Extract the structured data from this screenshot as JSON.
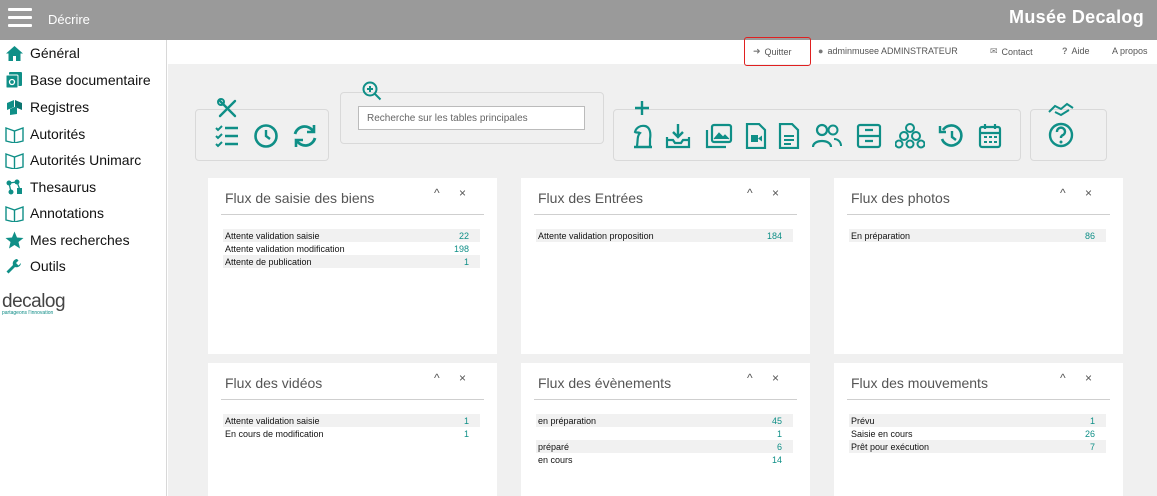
{
  "header": {
    "menu_label": "Décrire",
    "brand": "Musée Decalog"
  },
  "sidebar": {
    "items": [
      {
        "label": "Général",
        "icon": "home-icon"
      },
      {
        "label": "Base documentaire",
        "icon": "documents-icon"
      },
      {
        "label": "Registres",
        "icon": "boxes-icon"
      },
      {
        "label": "Autorités",
        "icon": "book-icon"
      },
      {
        "label": "Autorités Unimarc",
        "icon": "book-icon"
      },
      {
        "label": "Thesaurus",
        "icon": "thesaurus-icon"
      },
      {
        "label": "Annotations",
        "icon": "book-icon"
      },
      {
        "label": "Mes recherches",
        "icon": "star-icon"
      },
      {
        "label": "Outils",
        "icon": "wrench-icon"
      }
    ],
    "logo": {
      "word": "decalog",
      "tagline": "partageons l'innovation"
    }
  },
  "topnav": {
    "quit": "Quitter",
    "user": "adminmusee ADMINSTRATEUR",
    "contact": "Contact",
    "help": "Aide",
    "about": "A propos"
  },
  "search": {
    "placeholder": "Recherche sur les tables principales"
  },
  "colors": {
    "accent": "#0f8f87",
    "topbar": "#9a9a9a",
    "highlight_border": "#e02020"
  },
  "panels": [
    {
      "title": "Flux de saisie des biens",
      "rows": [
        {
          "label": "Attente validation saisie",
          "value": "22"
        },
        {
          "label": "Attente validation modification",
          "value": "198"
        },
        {
          "label": "Attente de publication",
          "value": "1"
        }
      ]
    },
    {
      "title": "Flux des Entrées",
      "rows": [
        {
          "label": "Attente validation proposition",
          "value": "184"
        }
      ]
    },
    {
      "title": "Flux des photos",
      "rows": [
        {
          "label": "En préparation",
          "value": "86"
        }
      ]
    },
    {
      "title": "Flux des vidéos",
      "rows": [
        {
          "label": "Attente validation saisie",
          "value": "1"
        },
        {
          "label": "En cours de modification",
          "value": "1"
        }
      ]
    },
    {
      "title": "Flux des évènements",
      "rows": [
        {
          "label": "en préparation",
          "value": "45"
        },
        {
          "label": "",
          "value": "1"
        },
        {
          "label": "préparé",
          "value": "6"
        },
        {
          "label": "en cours",
          "value": "14"
        }
      ]
    },
    {
      "title": "Flux des mouvements",
      "rows": [
        {
          "label": "Prévu",
          "value": "1"
        },
        {
          "label": "Saisie en cours",
          "value": "26"
        },
        {
          "label": "Prêt pour exécution",
          "value": "7"
        }
      ]
    }
  ],
  "panel_controls": {
    "collapse": "^",
    "close": "×"
  }
}
